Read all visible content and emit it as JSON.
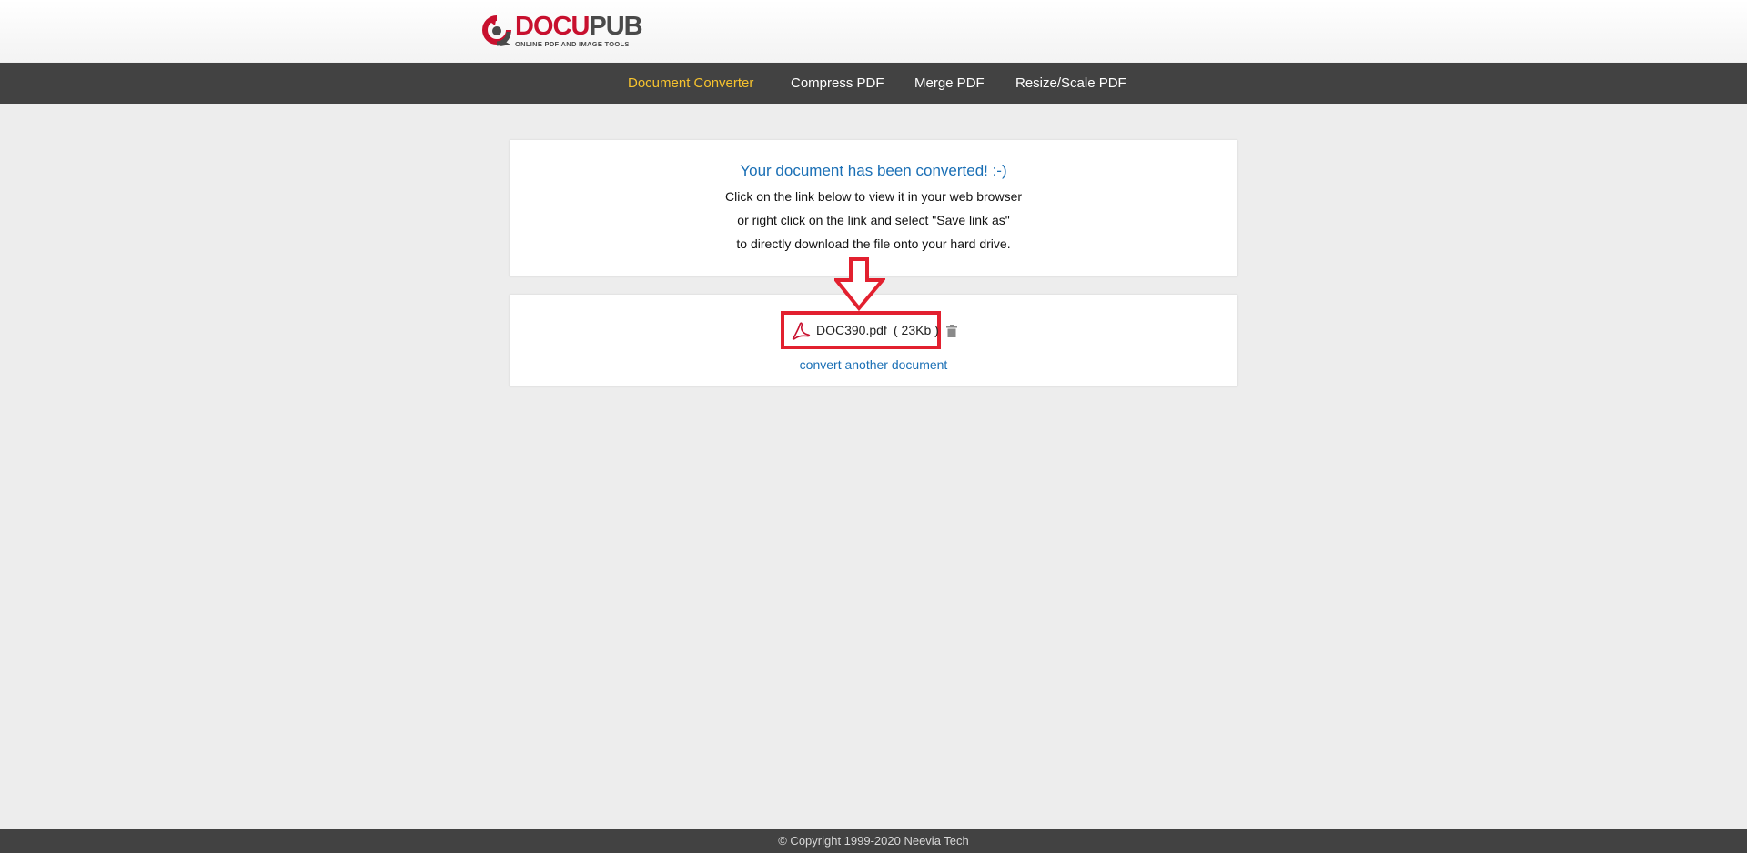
{
  "brand": {
    "name_part1": "DOCU",
    "name_part2": "PUB",
    "tagline": "ONLINE PDF AND IMAGE TOOLS",
    "colors": {
      "red": "#c8102e",
      "gray": "#4a4a4a"
    }
  },
  "nav": {
    "items": [
      {
        "label": "Document Converter",
        "active": true
      },
      {
        "label": "Compress PDF",
        "active": false
      },
      {
        "label": "Merge PDF",
        "active": false
      },
      {
        "label": "Resize/Scale PDF",
        "active": false
      }
    ],
    "active_color": "#f7c32e"
  },
  "result": {
    "title": "Your document has been converted! :-)",
    "lines": [
      "Click on the link below to view it in your web browser",
      "or right click on the link and select \"Save link as\"",
      "to directly download the file onto your hard drive."
    ]
  },
  "file": {
    "name": "DOC390.pdf",
    "size": "( 23Kb )",
    "icon": "pdf-icon",
    "delete_icon": "trash-icon"
  },
  "convert_another": "convert another document",
  "annotation": {
    "arrow": "down-arrow-icon",
    "highlight_color": "#e2202f"
  },
  "footer": {
    "copyright": "© Copyright 1999-2020 Neevia Tech"
  }
}
